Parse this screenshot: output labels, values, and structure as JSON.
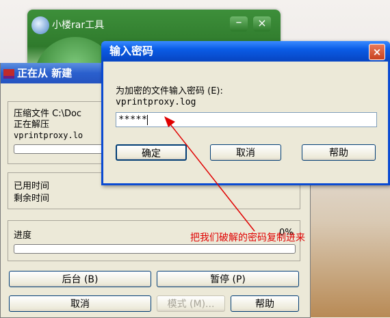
{
  "background_window": {
    "title": "小楼rar工具",
    "min": "–",
    "close": "×"
  },
  "rar_window": {
    "title": "正在从 新建",
    "archive_label": "压缩文件 C:\\Doc",
    "extracting": "正在解压",
    "file": "vprintproxy.lo",
    "elapsed_label": "已用时间",
    "remaining_label": "剩余时间",
    "progress_label": "进度",
    "progress_pct": "0%",
    "buttons": {
      "background": "后台 (B)",
      "pause": "暂停 (P)",
      "cancel": "取消",
      "mode": "模式 (M)...",
      "help": "帮助"
    }
  },
  "password_dialog": {
    "title": "输入密码",
    "prompt": "为加密的文件输入密码 (E):",
    "file": "vprintproxy.log",
    "password_value": "*****",
    "buttons": {
      "ok": "确定",
      "cancel": "取消",
      "help": "帮助"
    },
    "close": "×"
  },
  "annotation": {
    "text": "把我们破解的密码复制进来",
    "color": "#e00000"
  }
}
